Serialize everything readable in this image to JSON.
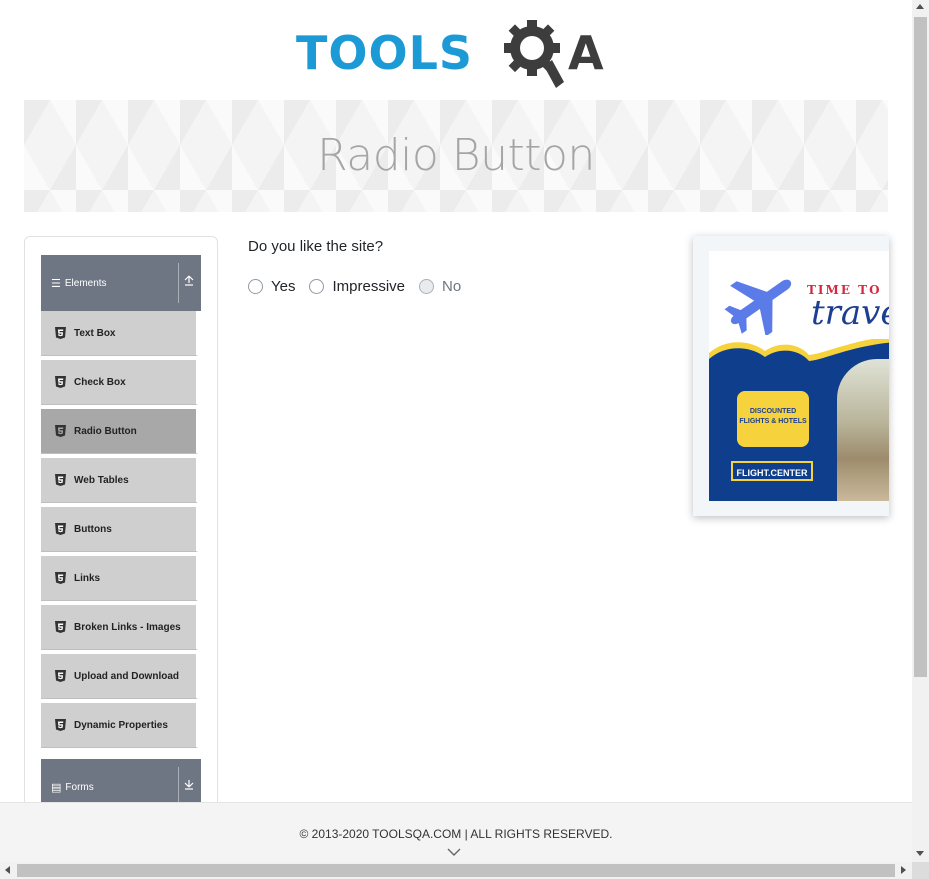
{
  "logo": {
    "text": "TOOLS",
    "suffix": "A"
  },
  "page": {
    "title": "Radio Button"
  },
  "sidebar": {
    "group_elements": {
      "label": "Elements",
      "icon": "list-icon",
      "toggle_icon": "collapse-up-icon"
    },
    "items": [
      {
        "label": "Text Box",
        "icon": "html5-icon"
      },
      {
        "label": "Check Box",
        "icon": "html5-icon"
      },
      {
        "label": "Radio Button",
        "icon": "html5-icon",
        "active": true
      },
      {
        "label": "Web Tables",
        "icon": "html5-icon"
      },
      {
        "label": "Buttons",
        "icon": "html5-icon"
      },
      {
        "label": "Links",
        "icon": "html5-icon"
      },
      {
        "label": "Broken Links - Images",
        "icon": "html5-icon"
      },
      {
        "label": "Upload and Download",
        "icon": "html5-icon"
      },
      {
        "label": "Dynamic Properties",
        "icon": "html5-icon"
      }
    ],
    "group_forms": {
      "label": "Forms",
      "icon": "form-icon",
      "toggle_icon": "expand-down-icon"
    }
  },
  "main": {
    "question": "Do you like the site?",
    "options": [
      {
        "label": "Yes",
        "disabled": false
      },
      {
        "label": "Impressive",
        "disabled": false
      },
      {
        "label": "No",
        "disabled": true
      }
    ]
  },
  "ad": {
    "title_line1": "TIME TO",
    "title_line2": "travel",
    "bubble_line1": "DISCOUNTED",
    "bubble_line2": "FLIGHTS & HOTELS",
    "brand": "FLIGHT.CENTER",
    "colors": {
      "navy": "#0f3f8c",
      "yellow": "#f6d33d",
      "red": "#d8283f",
      "plane": "#5b7ce8"
    }
  },
  "footer": {
    "copyright": "© 2013-2020 TOOLSQA.COM | ALL RIGHTS RESERVED."
  },
  "colors": {
    "brand_blue": "#1c9ad6",
    "dark_gray": "#3d3d3d",
    "sidebar_header": "#6f7683",
    "menu_item": "#cfcfcf",
    "menu_active": "#a8a8a8"
  }
}
